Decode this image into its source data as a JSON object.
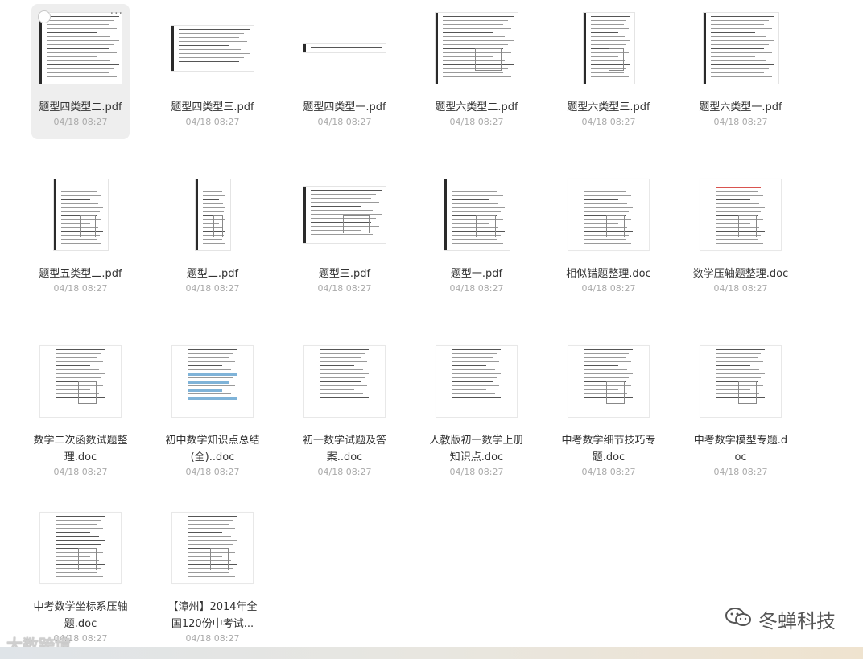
{
  "files": [
    {
      "name": "题型四类型二.pdf",
      "date": "04/18 08:27",
      "type": "pdf",
      "selected": true
    },
    {
      "name": "题型四类型三.pdf",
      "date": "04/18 08:27",
      "type": "pdf"
    },
    {
      "name": "题型四类型一.pdf",
      "date": "04/18 08:27",
      "type": "pdf"
    },
    {
      "name": "题型六类型二.pdf",
      "date": "04/18 08:27",
      "type": "pdf"
    },
    {
      "name": "题型六类型三.pdf",
      "date": "04/18 08:27",
      "type": "pdf"
    },
    {
      "name": "题型六类型一.pdf",
      "date": "04/18 08:27",
      "type": "pdf"
    },
    {
      "name": "题型五类型二.pdf",
      "date": "04/18 08:27",
      "type": "pdf"
    },
    {
      "name": "题型二.pdf",
      "date": "04/18 08:27",
      "type": "pdf"
    },
    {
      "name": "题型三.pdf",
      "date": "04/18 08:27",
      "type": "pdf"
    },
    {
      "name": "题型一.pdf",
      "date": "04/18 08:27",
      "type": "pdf"
    },
    {
      "name": "相似错题整理.doc",
      "date": "04/18 08:27",
      "type": "doc"
    },
    {
      "name": "数学压轴题整理.doc",
      "date": "04/18 08:27",
      "type": "doc"
    },
    {
      "name": "数学二次函数试题整理.doc",
      "date": "04/18 08:27",
      "type": "doc"
    },
    {
      "name": "初中数学知识点总结(全)..doc",
      "date": "04/18 08:27",
      "type": "doc"
    },
    {
      "name": "初一数学试题及答案..doc",
      "date": "04/18 08:27",
      "type": "doc"
    },
    {
      "name": "人教版初一数学上册知识点.doc",
      "date": "04/18 08:27",
      "type": "doc"
    },
    {
      "name": "中考数学细节技巧专题.doc",
      "date": "04/18 08:27",
      "type": "doc"
    },
    {
      "name": "中考数学模型专题.doc",
      "date": "04/18 08:27",
      "type": "doc"
    },
    {
      "name": "中考数学坐标系压轴题.doc",
      "date": "04/18 08:27",
      "type": "doc"
    },
    {
      "name": "【漳州】2014年全国120份中考试...",
      "date": "04/18 08:27",
      "type": "doc"
    }
  ],
  "selection": {
    "more_label": "···"
  },
  "watermarks": {
    "right_text": "冬蝉科技",
    "left_text": "大数跨境",
    "wechat_icon": "wechat-icon"
  },
  "colors": {
    "selected_bg": "#eeeeee",
    "name": "#333333",
    "date": "#aaaaaa"
  }
}
